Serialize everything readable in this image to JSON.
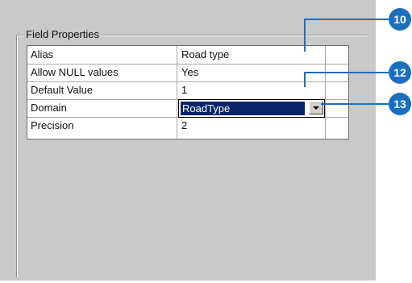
{
  "group": {
    "title": "Field Properties"
  },
  "properties": [
    {
      "label": "Alias",
      "value": "Road type"
    },
    {
      "label": "Allow NULL values",
      "value": "Yes"
    },
    {
      "label": "Default Value",
      "value": "1"
    },
    {
      "label": "Domain",
      "value": "RoadType"
    },
    {
      "label": "Precision",
      "value": "2"
    }
  ],
  "callouts": [
    "10",
    "12",
    "13"
  ],
  "colors": {
    "callout": "#1b6fbf",
    "selection": "#0a246a",
    "panel": "#c9c9c9"
  }
}
